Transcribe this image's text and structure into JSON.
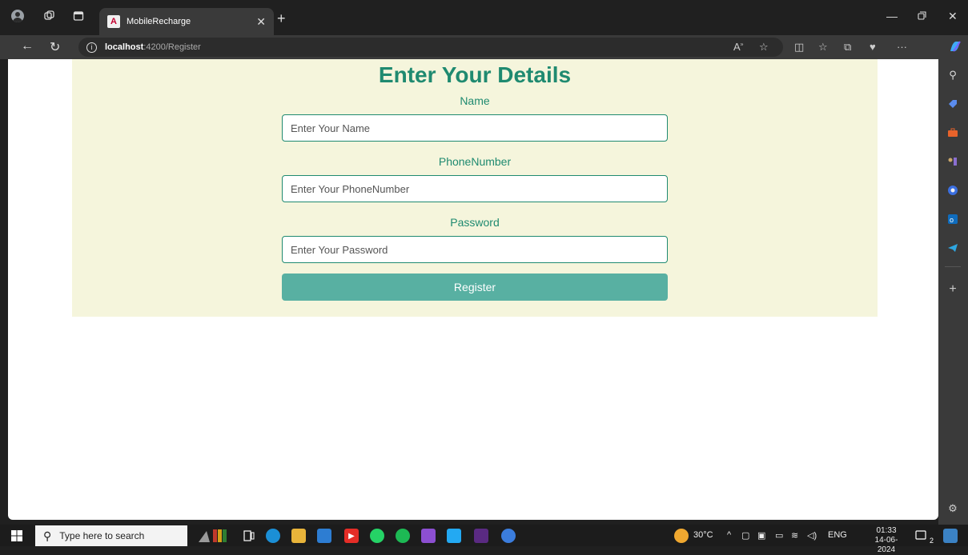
{
  "browser": {
    "tab_title": "MobileRecharge",
    "tab_favicon": "A",
    "url_host": "localhost",
    "url_path": ":4200/Register"
  },
  "form": {
    "heading": "Enter Your Details",
    "name_label": "Name",
    "name_placeholder": "Enter Your Name",
    "phone_label": "PhoneNumber",
    "phone_placeholder": "Enter Your PhoneNumber",
    "password_label": "Password",
    "password_placeholder": "Enter Your Password",
    "register_label": "Register"
  },
  "taskbar": {
    "search_placeholder": "Type here to search",
    "temperature": "30°C",
    "language": "ENG",
    "time": "01:33",
    "date": "14-06-2024",
    "notification_count": "2"
  },
  "colors": {
    "accent": "#1f8a70",
    "panel_bg": "#f5f5dc",
    "button_bg": "#58b0a2"
  }
}
